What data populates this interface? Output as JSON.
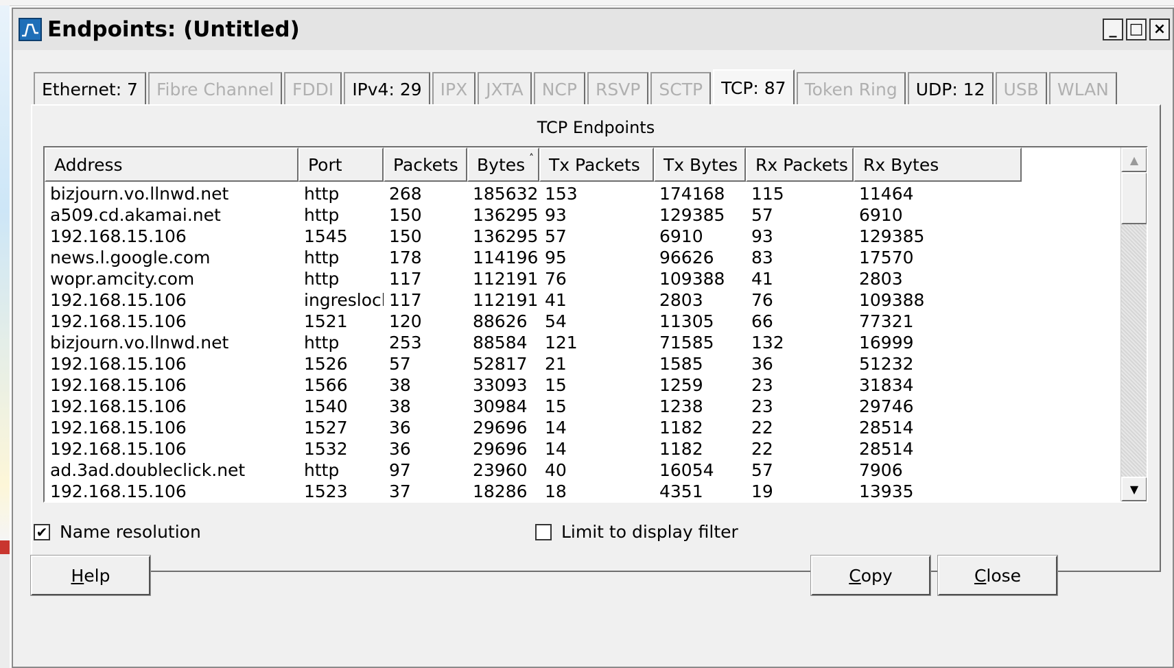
{
  "window": {
    "title": "Endpoints: (Untitled)",
    "controls": {
      "minimize": "_",
      "maximize": "□",
      "close": "×"
    }
  },
  "tabs": [
    {
      "label": "Ethernet: 7",
      "enabled": true,
      "selected": false
    },
    {
      "label": "Fibre Channel",
      "enabled": false,
      "selected": false
    },
    {
      "label": "FDDI",
      "enabled": false,
      "selected": false
    },
    {
      "label": "IPv4: 29",
      "enabled": true,
      "selected": false
    },
    {
      "label": "IPX",
      "enabled": false,
      "selected": false
    },
    {
      "label": "JXTA",
      "enabled": false,
      "selected": false
    },
    {
      "label": "NCP",
      "enabled": false,
      "selected": false
    },
    {
      "label": "RSVP",
      "enabled": false,
      "selected": false
    },
    {
      "label": "SCTP",
      "enabled": false,
      "selected": false
    },
    {
      "label": "TCP: 87",
      "enabled": true,
      "selected": true
    },
    {
      "label": "Token Ring",
      "enabled": false,
      "selected": false
    },
    {
      "label": "UDP: 12",
      "enabled": true,
      "selected": false
    },
    {
      "label": "USB",
      "enabled": false,
      "selected": false
    },
    {
      "label": "WLAN",
      "enabled": false,
      "selected": false
    }
  ],
  "panel": {
    "title": "TCP Endpoints",
    "columns": [
      "Address",
      "Port",
      "Packets",
      "Bytes",
      "Tx Packets",
      "Tx Bytes",
      "Rx Packets",
      "Rx Bytes"
    ],
    "sort_indicator": "˄",
    "rows": [
      [
        "bizjourn.vo.llnwd.net",
        "http",
        "268",
        "185632",
        "153",
        "174168",
        "115",
        "11464"
      ],
      [
        "a509.cd.akamai.net",
        "http",
        "150",
        "136295",
        "93",
        "129385",
        "57",
        "6910"
      ],
      [
        "192.168.15.106",
        "1545",
        "150",
        "136295",
        "57",
        "6910",
        "93",
        "129385"
      ],
      [
        "news.l.google.com",
        "http",
        "178",
        "114196",
        "95",
        "96626",
        "83",
        "17570"
      ],
      [
        "wopr.amcity.com",
        "http",
        "117",
        "112191",
        "76",
        "109388",
        "41",
        "2803"
      ],
      [
        "192.168.15.106",
        "ingreslock",
        "117",
        "112191",
        "41",
        "2803",
        "76",
        "109388"
      ],
      [
        "192.168.15.106",
        "1521",
        "120",
        "88626",
        "54",
        "11305",
        "66",
        "77321"
      ],
      [
        "bizjourn.vo.llnwd.net",
        "http",
        "253",
        "88584",
        "121",
        "71585",
        "132",
        "16999"
      ],
      [
        "192.168.15.106",
        "1526",
        "57",
        "52817",
        "21",
        "1585",
        "36",
        "51232"
      ],
      [
        "192.168.15.106",
        "1566",
        "38",
        "33093",
        "15",
        "1259",
        "23",
        "31834"
      ],
      [
        "192.168.15.106",
        "1540",
        "38",
        "30984",
        "15",
        "1238",
        "23",
        "29746"
      ],
      [
        "192.168.15.106",
        "1527",
        "36",
        "29696",
        "14",
        "1182",
        "22",
        "28514"
      ],
      [
        "192.168.15.106",
        "1532",
        "36",
        "29696",
        "14",
        "1182",
        "22",
        "28514"
      ],
      [
        "ad.3ad.doubleclick.net",
        "http",
        "97",
        "23960",
        "40",
        "16054",
        "57",
        "7906"
      ],
      [
        "192.168.15.106",
        "1523",
        "37",
        "18286",
        "18",
        "4351",
        "19",
        "13935"
      ]
    ]
  },
  "options": {
    "name_resolution": {
      "label": "Name resolution",
      "checked": true
    },
    "limit_filter": {
      "label": "Limit to display filter",
      "checked": false
    }
  },
  "buttons": {
    "help": {
      "mnemonic": "H",
      "rest": "elp"
    },
    "copy": {
      "mnemonic": "C",
      "rest": "opy"
    },
    "close": {
      "mnemonic": "C",
      "rest": "lose"
    }
  },
  "icons": {
    "app": "wireshark-graph-icon",
    "scroll_up": "scroll-up-arrow-icon",
    "scroll_down": "scroll-down-arrow-icon",
    "checkmark": "checkmark-icon"
  }
}
